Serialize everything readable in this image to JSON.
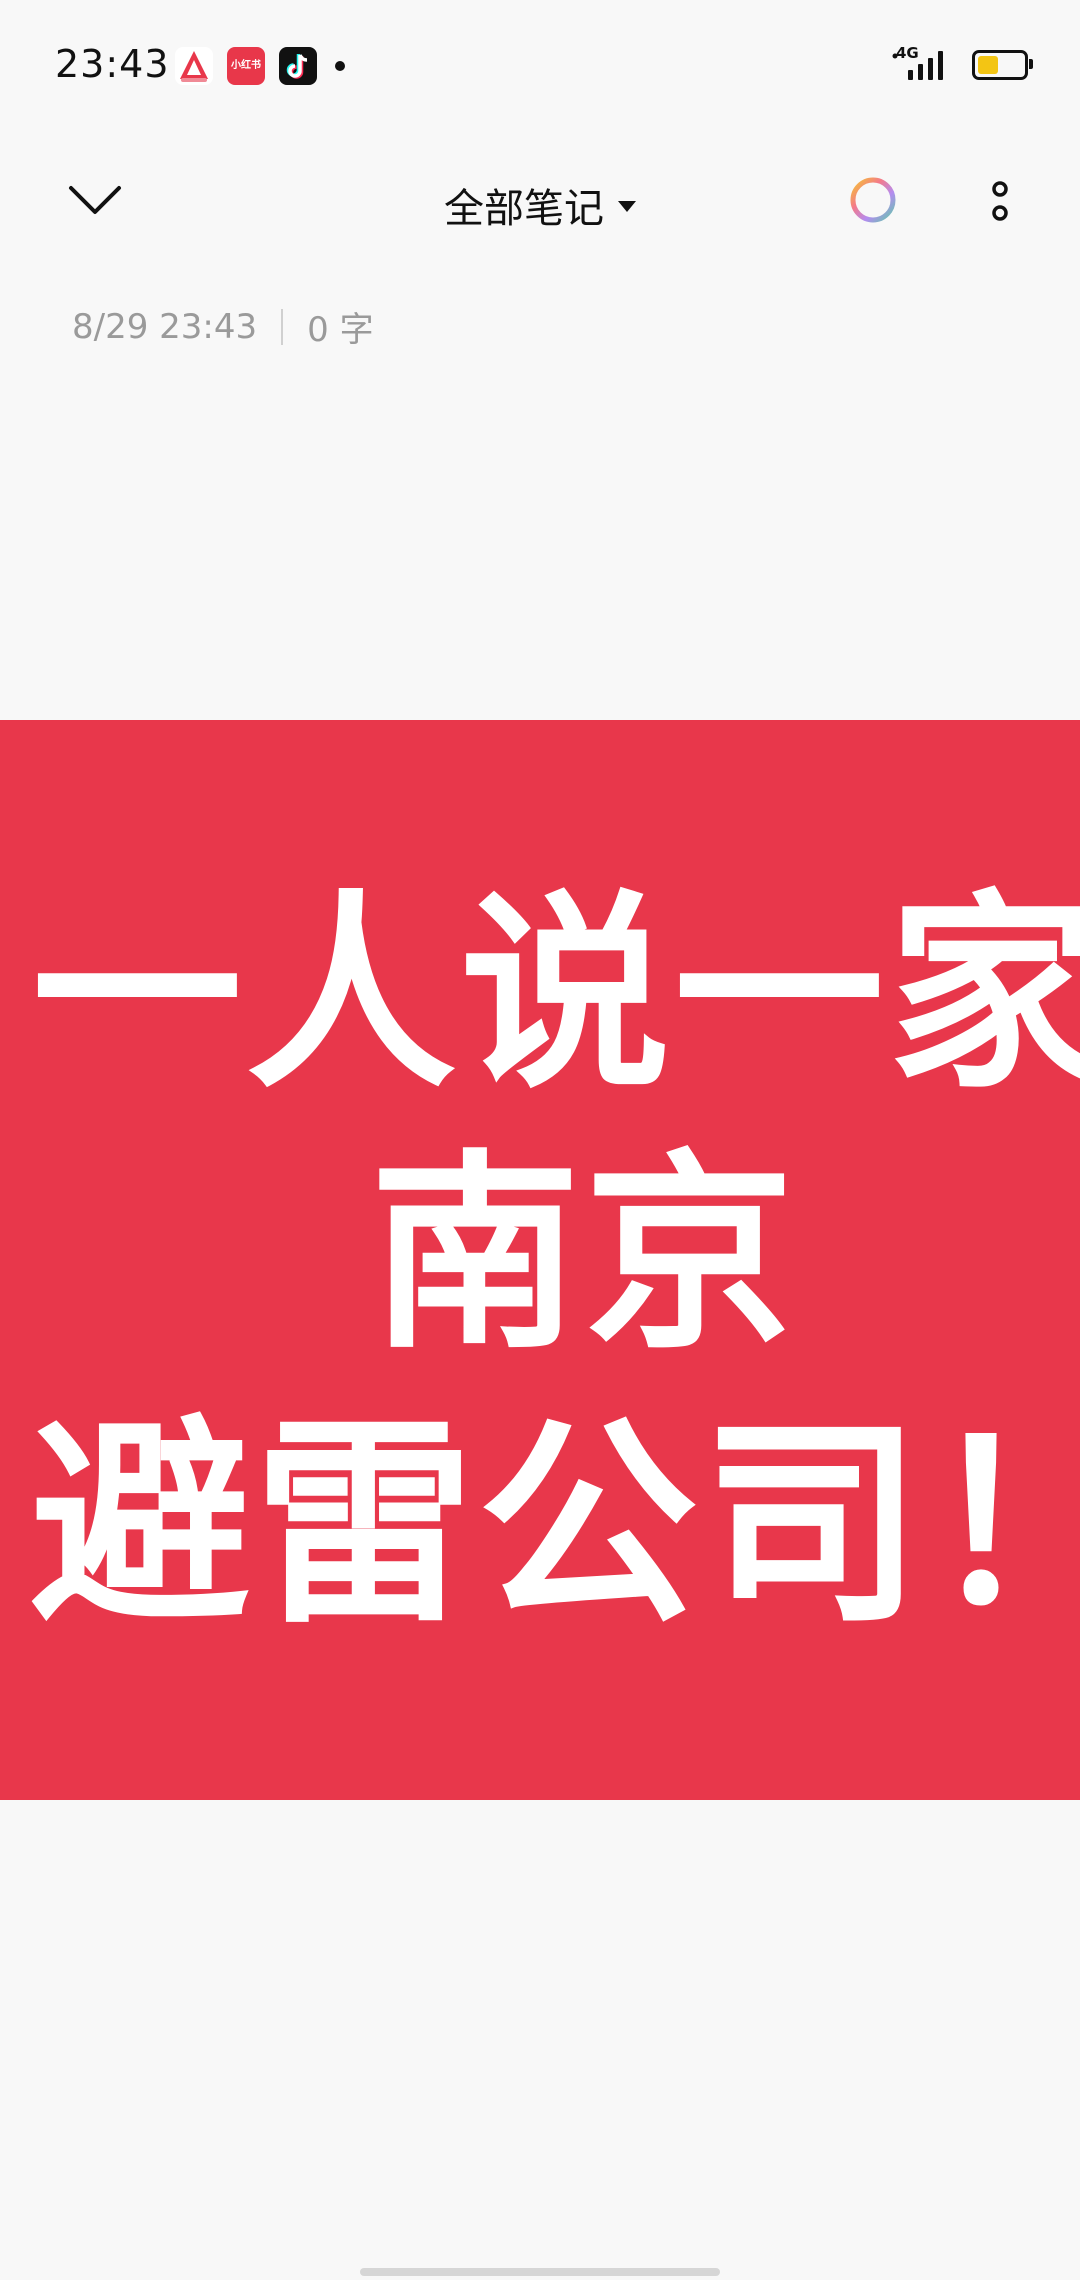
{
  "status_bar": {
    "time": "23:43",
    "notification_app_red_label": "小红书",
    "network_label": "4G",
    "battery_level": 0.45,
    "battery_color": "#f3c514"
  },
  "toolbar": {
    "folder_label": "全部笔记",
    "back_icon": "chevron-down-icon",
    "theme_icon": "color-ring-icon",
    "more_icon": "more-vertical-icon"
  },
  "note": {
    "timestamp": "8/29 23:43",
    "word_count": "0 字"
  },
  "image": {
    "background_color": "#e8374b",
    "line1": "一人说一家",
    "line2": "南京",
    "line3": "避雷公司！"
  }
}
